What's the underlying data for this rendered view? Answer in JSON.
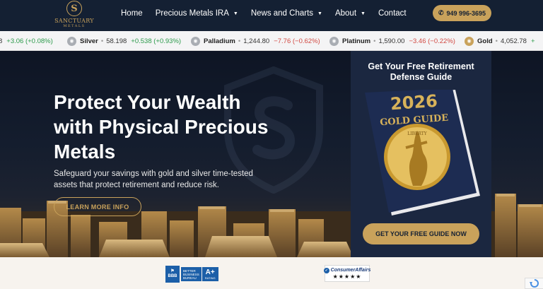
{
  "brand": {
    "name": "SANCTUARY",
    "sub": "METALS",
    "mark": "S"
  },
  "nav": {
    "items": [
      {
        "label": "Home",
        "dropdown": false
      },
      {
        "label": "Precious Metals IRA",
        "dropdown": true
      },
      {
        "label": "News and Charts",
        "dropdown": true
      },
      {
        "label": "About",
        "dropdown": true
      },
      {
        "label": "Contact",
        "dropdown": false
      }
    ],
    "phone": "949 996-3695",
    "phone_icon": "phone-icon"
  },
  "ticker": [
    {
      "name": "",
      "price": "",
      "change": "+3.06 (+0.08%)",
      "dir": "up",
      "icon": ""
    },
    {
      "name": "Silver",
      "price": "58.198",
      "change": "+0.538 (+0.93%)",
      "dir": "up",
      "icon": "silver-coin-icon"
    },
    {
      "name": "Palladium",
      "price": "1,244.80",
      "change": "−7.76 (−0.62%)",
      "dir": "down",
      "icon": "palladium-coin-icon"
    },
    {
      "name": "Platinum",
      "price": "1,590.00",
      "change": "−3.46 (−0.22%)",
      "dir": "down",
      "icon": "platinum-coin-icon"
    },
    {
      "name": "Gold",
      "price": "4,052.78",
      "change": "+",
      "dir": "up",
      "icon": "gold-coin-icon"
    }
  ],
  "hero": {
    "title": "Protect Your Wealth with Physical Precious Metals",
    "subtitle": "Safeguard your savings with gold and silver time-tested assets that protect retirement and reduce risk.",
    "cta": "LEARN MORE INFO"
  },
  "guide": {
    "title": "Get Your Free Retirement Defense Guide",
    "book_year": "2026",
    "book_title": "GOLD GUIDE",
    "book_coin_text": "LIBERTY",
    "cta": "GET YOUR FREE GUIDE NOW"
  },
  "trust": {
    "bbb": {
      "abbr": "BBB",
      "text_lines": [
        "BETTER",
        "BUSINESS",
        "BUREAU"
      ],
      "grade": "A+",
      "grade_label": "RATING"
    },
    "consumer_affairs": {
      "name": "ConsumerAffairs",
      "stars": "★★★★★"
    }
  },
  "colors": {
    "navy": "#142033",
    "gold": "#c9a25b",
    "up": "#2b9a4a",
    "down": "#d24a43"
  }
}
